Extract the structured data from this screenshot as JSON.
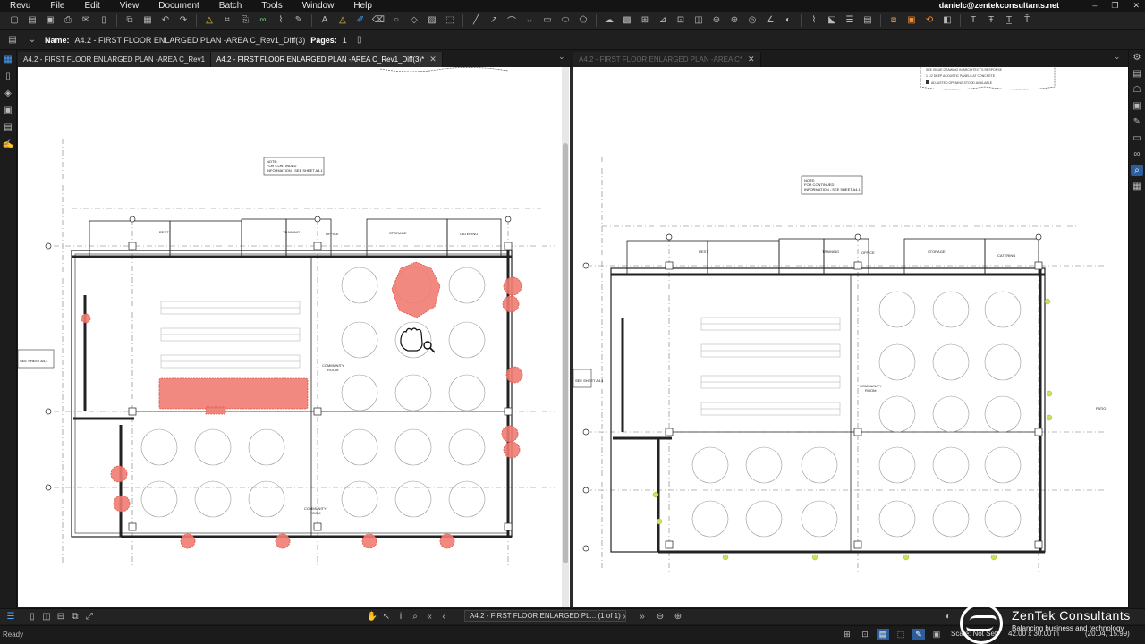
{
  "menu": {
    "items": [
      "Revu",
      "File",
      "Edit",
      "View",
      "Document",
      "Batch",
      "Tools",
      "Window",
      "Help"
    ],
    "user": "danielc@zentekconsultants.net",
    "window_buttons": [
      "–",
      "❐",
      "✕"
    ]
  },
  "propbar": {
    "name_label": "Name:",
    "name_value": "A4.2 - FIRST FLOOR ENLARGED PLAN -AREA C_Rev1_Diff(3)",
    "pages_label": "Pages:",
    "pages_value": "1"
  },
  "tabs_left": [
    {
      "label": "A4.2 - FIRST FLOOR ENLARGED PLAN -AREA C_Rev1"
    },
    {
      "label": "A4.2 - FIRST FLOOR ENLARGED PLAN -AREA C_Rev1_Diff(3)*",
      "close": "✕"
    }
  ],
  "tabs_right": [
    {
      "label": "A4.2 - FIRST FLOOR ENLARGED PLAN -AREA C*",
      "close": "✕"
    }
  ],
  "tab_menu_glyph": "⌄",
  "drawing": {
    "note_line1": "NOTE:",
    "note_line2": "FOR CONTINUED",
    "note_line3": "INFORMATION - SEE SHEET A4.1",
    "side_note": "SEE SHEET A4.4",
    "rooms": [
      "REST",
      "TRAINING",
      "OFFICE",
      "STORAGE",
      "CATERING"
    ],
    "community_room_line1": "COMMUNITY",
    "community_room_line2": "ROOM",
    "patio": "PATIO",
    "legend_line1": "SEE ISSUE DRAWING IN ARCHITECT'S RESPONSE",
    "legend_line2": "1 1/2 DEEP ACOUSTIC PANELS AT CONCRETE",
    "legend_line3": "ADJUSTED OPENING STOOD AVAILABLE"
  },
  "statusbar": {
    "page_box": "A4.2 - FIRST FLOOR ENLARGED PL... (1 of 1)"
  },
  "bottom": {
    "ready": "Ready",
    "scale": "Scale: Not Set",
    "dims": "42.00 x 30.00 in",
    "coords": "(20.04, 15.99)"
  },
  "logo": {
    "name": "ZenTek Consultants",
    "tagline": "Balancing business and technology"
  },
  "colors": {
    "accent": "#2d5d9a",
    "diff_red": "#f07c72",
    "diff_green": "#c8e35a"
  }
}
